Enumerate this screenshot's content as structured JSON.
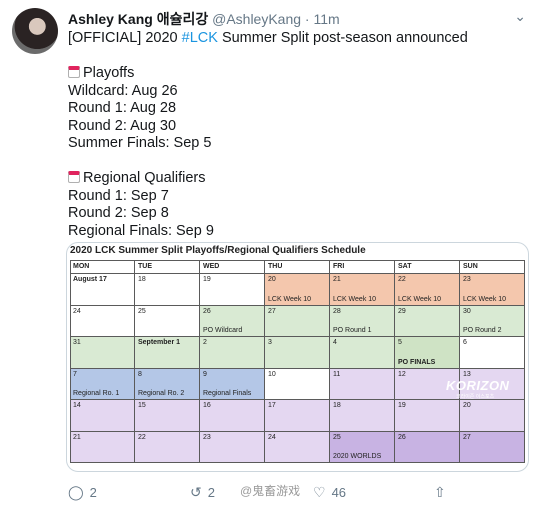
{
  "tweet": {
    "name": "Ashley Kang 애슐리강",
    "handle": "@AshleyKang · 11m",
    "line1_pre": "[OFFICIAL] 2020 ",
    "hashtag": "#LCK",
    "line1_post": " Summer Split post-season announced",
    "playoffs_heading": "Playoffs",
    "playoffs": [
      "Wildcard: Aug 26",
      "Round 1: Aug 28",
      "Round 2: Aug 30",
      "Summer Finals: Sep 5"
    ],
    "regional_heading": "Regional Qualifiers",
    "regional": [
      "Round 1: Sep 7",
      "Round 2: Sep 8",
      "Regional Finals: Sep 9"
    ]
  },
  "schedule": {
    "title": "2020 LCK Summer Split Playoffs/Regional Qualifiers Schedule",
    "days": [
      "MON",
      "TUE",
      "WED",
      "THU",
      "FRI",
      "SAT",
      "SUN"
    ],
    "rows": [
      [
        {
          "d": "August 17",
          "c": "white",
          "b": true
        },
        {
          "d": "18",
          "c": "white"
        },
        {
          "d": "19",
          "c": "white"
        },
        {
          "d": "20",
          "n": "LCK Week 10",
          "c": "orange"
        },
        {
          "d": "21",
          "n": "LCK Week 10",
          "c": "orange"
        },
        {
          "d": "22",
          "n": "LCK Week 10",
          "c": "orange"
        },
        {
          "d": "23",
          "n": "LCK Week 10",
          "c": "orange"
        }
      ],
      [
        {
          "d": "24",
          "c": "white"
        },
        {
          "d": "25",
          "c": "white"
        },
        {
          "d": "26",
          "n": "PO Wildcard",
          "c": "green"
        },
        {
          "d": "27",
          "c": "green"
        },
        {
          "d": "28",
          "n": "PO Round 1",
          "c": "green"
        },
        {
          "d": "29",
          "c": "green"
        },
        {
          "d": "30",
          "n": "PO Round 2",
          "c": "green"
        }
      ],
      [
        {
          "d": "31",
          "c": "green"
        },
        {
          "d": "September 1",
          "c": "green",
          "b": true
        },
        {
          "d": "2",
          "c": "green"
        },
        {
          "d": "3",
          "c": "green"
        },
        {
          "d": "4",
          "c": "green"
        },
        {
          "d": "5",
          "n": "PO FINALS",
          "c": "green2",
          "nb": true
        },
        {
          "d": "6",
          "c": "white"
        }
      ],
      [
        {
          "d": "7",
          "n": "Regional Ro. 1",
          "c": "blue"
        },
        {
          "d": "8",
          "n": "Regional Ro. 2",
          "c": "blue"
        },
        {
          "d": "9",
          "n": "Regional Finals",
          "c": "blue"
        },
        {
          "d": "10",
          "c": "white"
        },
        {
          "d": "11",
          "c": "lav"
        },
        {
          "d": "12",
          "c": "lav"
        },
        {
          "d": "13",
          "c": "lav"
        }
      ],
      [
        {
          "d": "14",
          "c": "lav"
        },
        {
          "d": "15",
          "c": "lav"
        },
        {
          "d": "16",
          "c": "lav"
        },
        {
          "d": "17",
          "c": "lav"
        },
        {
          "d": "18",
          "c": "lav"
        },
        {
          "d": "19",
          "c": "lav"
        },
        {
          "d": "20",
          "c": "lav"
        }
      ],
      [
        {
          "d": "21",
          "c": "lav"
        },
        {
          "d": "22",
          "c": "lav"
        },
        {
          "d": "23",
          "c": "lav"
        },
        {
          "d": "24",
          "c": "lav"
        },
        {
          "d": "25",
          "n": "2020 WORLDS",
          "c": "purple"
        },
        {
          "d": "26",
          "c": "purple"
        },
        {
          "d": "27",
          "c": "purple"
        }
      ]
    ],
    "logo": "KORIZON",
    "logo_sub": "코라이즌 이스포츠"
  },
  "actions": {
    "reply_count": "2",
    "retweet_count": "2",
    "like_count": "46",
    "watermark": "@鬼畜游戏"
  },
  "icons": [
    "chevron-down-icon",
    "calendar-icon",
    "reply-icon",
    "retweet-icon",
    "like-icon",
    "share-icon"
  ]
}
